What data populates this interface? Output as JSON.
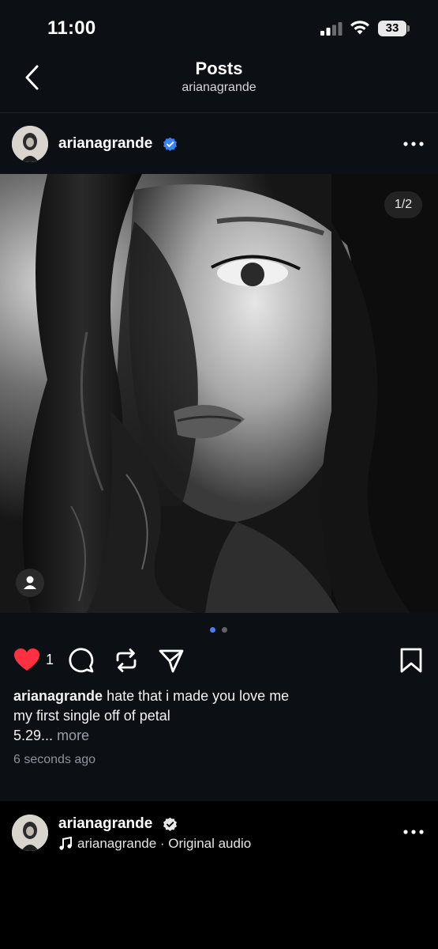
{
  "status_bar": {
    "time": "11:00",
    "battery": "33"
  },
  "header": {
    "title": "Posts",
    "subtitle": "arianagrande"
  },
  "post": {
    "username": "arianagrande",
    "counter": "1/2",
    "likes": "1",
    "caption_user": "arianagrande",
    "caption_lines": [
      "hate that i made you love me",
      "my first single off of petal",
      "5.29..."
    ],
    "more_label": "more",
    "time_ago": "6 seconds ago",
    "page_dots": 2,
    "active_page": 1
  },
  "next_post": {
    "username": "arianagrande",
    "audio": "arianagrande · Original audio"
  },
  "colors": {
    "accent": "#4a7cf2",
    "like": "#ff3040",
    "verified": "#3b82f6"
  }
}
